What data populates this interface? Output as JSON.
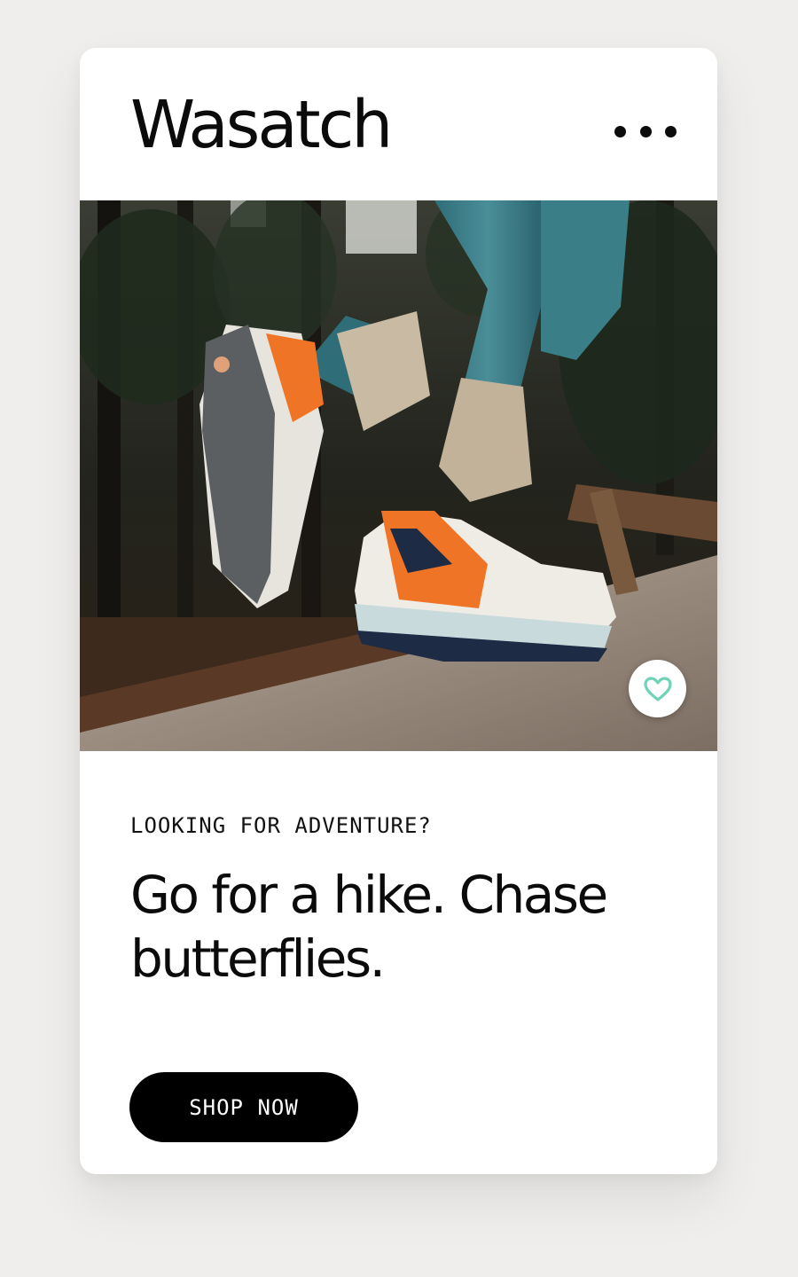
{
  "header": {
    "brand": "Wasatch",
    "menu_icon": "more-horizontal-icon"
  },
  "hero": {
    "image_subject": "hiking shoes on a log in a forest",
    "favorite_icon": "heart-outline-icon",
    "favorite_color": "#6fd3b8"
  },
  "content": {
    "eyebrow": "LOOKING FOR ADVENTURE?",
    "headline": "Go for a hike. Chase butterflies.",
    "cta_label": "SHOP NOW"
  },
  "colors": {
    "background": "#efeeec",
    "card": "#ffffff",
    "text": "#0b0b0b",
    "button": "#000000",
    "shoe_accent": "#f07426"
  }
}
